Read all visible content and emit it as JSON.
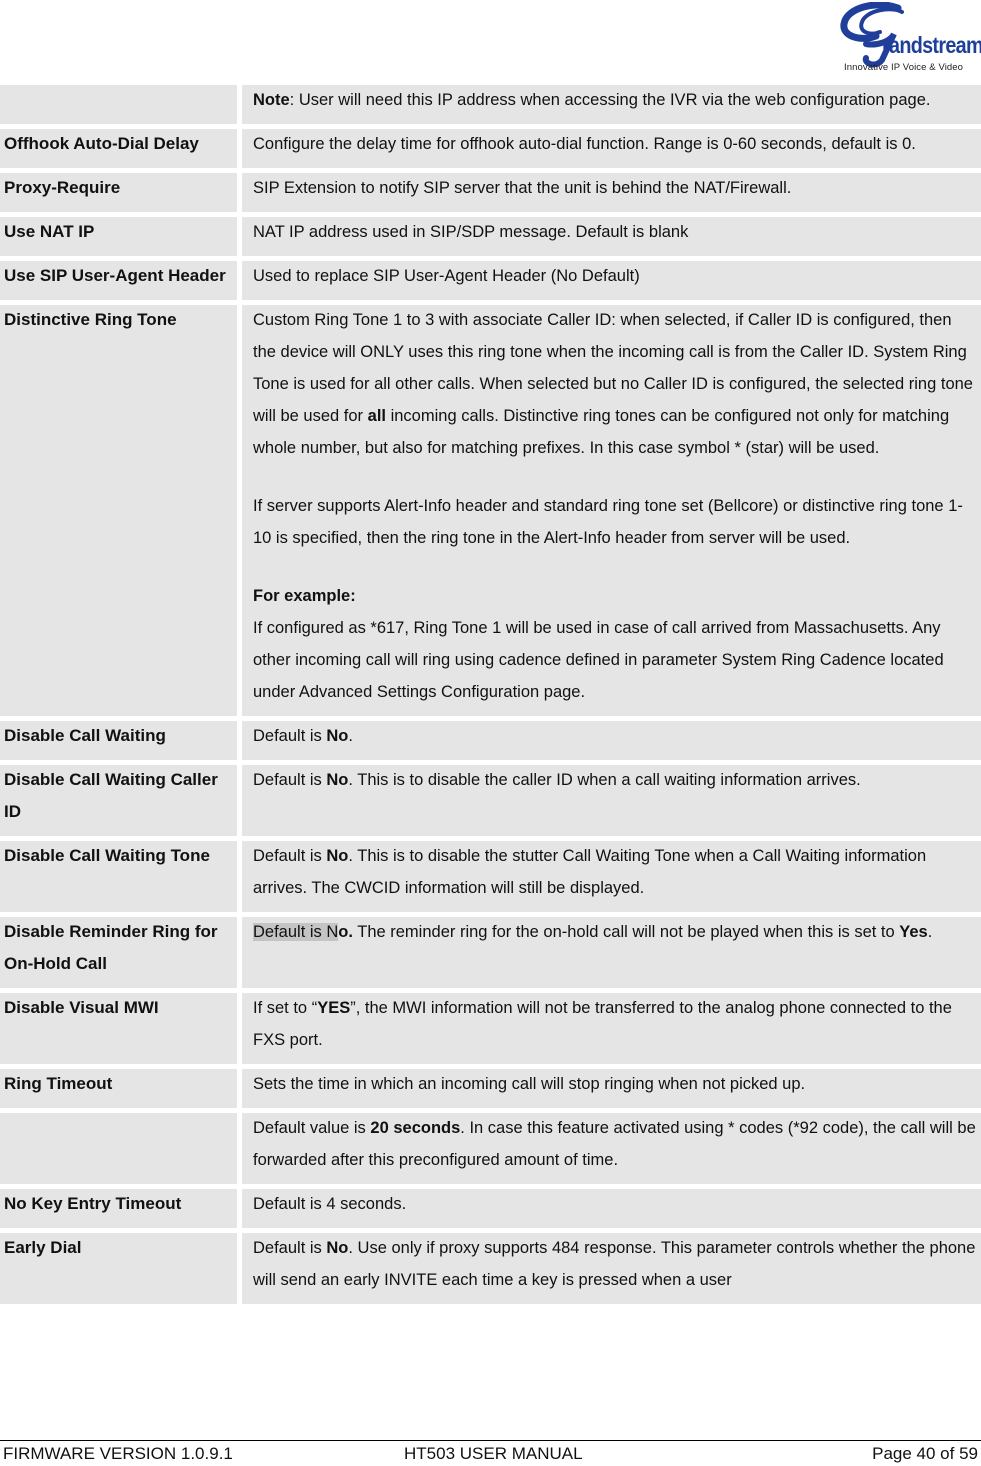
{
  "logo": {
    "brand": "randstream",
    "initial": "G",
    "tagline": "Innovative IP Voice & Video",
    "color": "#1f3f9b"
  },
  "rows": [
    {
      "name": "",
      "desc": [
        {
          "b": "Note"
        },
        {
          "t": ": User will need this IP address when accessing the IVR via the web configuration page."
        }
      ]
    },
    {
      "name": "Offhook Auto-Dial Delay",
      "desc": [
        {
          "t": "Configure the delay time for offhook auto-dial function. Range is 0-60 seconds, default is 0."
        }
      ]
    },
    {
      "name": "Proxy-Require",
      "desc": [
        {
          "t": "SIP Extension to notify SIP server that the unit is behind the NAT/Firewall."
        }
      ]
    },
    {
      "name": "Use NAT IP",
      "desc": [
        {
          "t": "NAT IP address used in SIP/SDP message.  Default is blank"
        }
      ]
    },
    {
      "name": "Use SIP User-Agent Header",
      "desc": [
        {
          "t": "Used to replace SIP User-Agent Header (No Default)"
        }
      ]
    },
    {
      "name": "Distinctive Ring Tone",
      "paragraphs": [
        [
          {
            "t": "Custom Ring Tone 1 to 3 with associate Caller ID: when selected, if Caller ID is configured, then the device will ONLY uses this ring tone when the incoming call is from the Caller ID.  System Ring Tone is used for all other calls.  When selected but no Caller ID is configured, the selected ring tone will be used for "
          },
          {
            "b": "all"
          },
          {
            "t": " incoming calls. Distinctive ring tones can be configured not only for matching whole number, but also for matching prefixes. In this case symbol * (star) will be used."
          }
        ],
        [
          {
            "t": "If server supports Alert-Info header and standard ring tone set (Bellcore) or distinctive ring tone 1-10 is specified, then the ring tone in the Alert-Info header from server will be used."
          }
        ],
        [
          {
            "b": "For example:"
          },
          {
            "br": true
          },
          {
            "t": "If configured as *617, Ring Tone 1 will be used in case of call arrived from Massachusetts. Any other incoming call will ring using cadence defined in parameter System Ring Cadence located under Advanced Settings Configuration page."
          }
        ]
      ]
    },
    {
      "name": "Disable Call Waiting",
      "desc": [
        {
          "t": "Default is "
        },
        {
          "b": "No"
        },
        {
          "t": "."
        }
      ]
    },
    {
      "name": "Disable Call Waiting Caller ID",
      "desc": [
        {
          "t": "Default is "
        },
        {
          "b": "No"
        },
        {
          "t": ". This is to disable the caller ID when a call waiting information arrives."
        }
      ]
    },
    {
      "name": "Disable Call Waiting Tone",
      "desc": [
        {
          "t": "Default is "
        },
        {
          "b": "No"
        },
        {
          "t": ". This is to disable the stutter Call Waiting Tone when a Call Waiting information arrives. The CWCID information will still be displayed."
        }
      ]
    },
    {
      "name": "Disable Reminder Ring for On-Hold Call",
      "desc": [
        {
          "hl": "Default is N"
        },
        {
          "b": "o."
        },
        {
          "t": "  The reminder ring for the on-hold call will not be played when this is set to "
        },
        {
          "b": "Yes"
        },
        {
          "t": "."
        }
      ]
    },
    {
      "name": "Disable Visual MWI",
      "desc": [
        {
          "t": "If set to “"
        },
        {
          "b": "YES"
        },
        {
          "t": "”, the MWI information will not be transferred to the analog phone connected to the FXS port."
        }
      ]
    },
    {
      "name": "Ring Timeout",
      "desc": [
        {
          "t": "Sets the time in which an incoming call will stop ringing when not picked up."
        }
      ]
    },
    {
      "name": "",
      "desc": [
        {
          "t": "Default value is "
        },
        {
          "b": "20 seconds"
        },
        {
          "t": ". In case this feature activated using * codes (*92 code), the call will be forwarded after this preconfigured amount of time."
        }
      ]
    },
    {
      "name": "No Key Entry Timeout",
      "desc": [
        {
          "t": "Default is 4 seconds."
        }
      ]
    },
    {
      "name": "Early Dial",
      "desc": [
        {
          "t": "Default is "
        },
        {
          "b": "No"
        },
        {
          "t": ".  Use only if proxy supports 484 response.  This parameter controls whether the phone will send an early INVITE each time a key is pressed when a user"
        }
      ]
    }
  ],
  "footer": {
    "firmware": "FIRMWARE VERSION 1.0.9.1",
    "manual": "HT503 USER MANUAL",
    "page": "Page 40 of 59"
  }
}
